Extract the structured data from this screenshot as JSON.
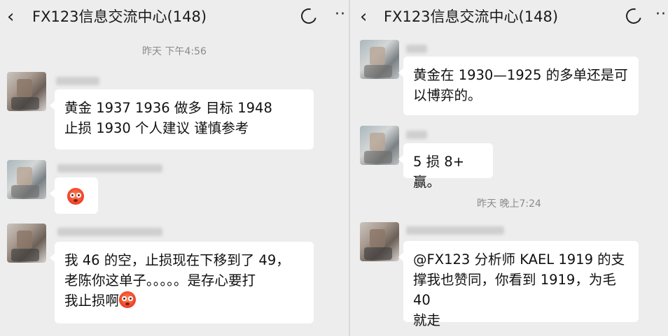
{
  "left": {
    "title": "FX123信息交流中心(148)",
    "timestamp": "昨天 下午4:56",
    "messages": [
      {
        "lines": [
          "黄金  1937  1936 做多  目标 1948",
          "止损 1930    个人建议  谨慎参考"
        ]
      },
      {
        "emoji": "flushed-face-emoji"
      },
      {
        "lines": [
          "我 46 的空，止损现在下移到了 49，",
          "老陈你这单子。。。。。是存心要打",
          "我止损啊"
        ],
        "trailing_emoji": "flushed-face-emoji"
      }
    ]
  },
  "right": {
    "title": "FX123信息交流中心(148)",
    "timestamp": "昨天 晚上7:24",
    "messages": [
      {
        "lines": [
          "黄金在 1930—1925 的多单还是可",
          "以博弈的。"
        ]
      },
      {
        "lines": [
          "5 损 8+ 赢。"
        ]
      },
      {
        "lines": [
          "@FX123 分析师 KAEL 1919 的支",
          "撑我也赞同，你看到 1919，为毛 40",
          "就走"
        ]
      }
    ]
  },
  "icons": {
    "back": "chevron-left-icon",
    "refresh": "refresh-icon",
    "more": "more-dots-icon"
  },
  "colors": {
    "background": "#ededed",
    "bubble": "#ffffff",
    "timestamp_text": "#8a8a8a"
  }
}
